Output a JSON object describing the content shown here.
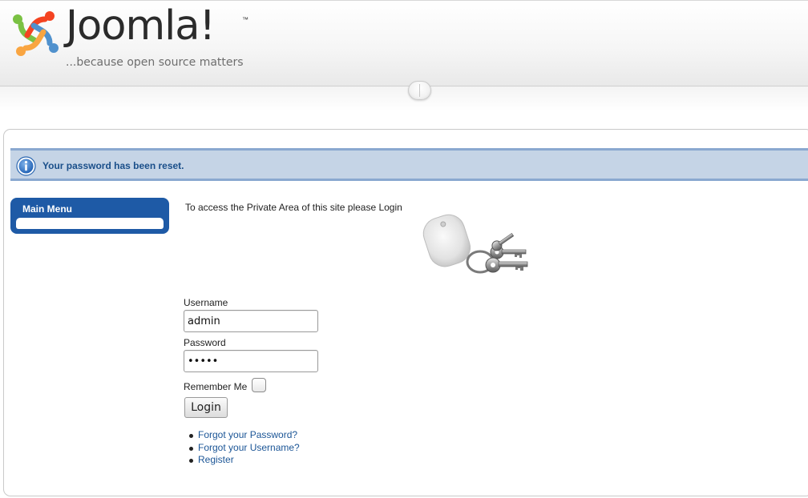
{
  "brand": {
    "name": "Joomla!",
    "wordmark": "Joomla!",
    "tagline": "...because open source matters",
    "logo_icon": "joomla-logo-icon",
    "logo_colors": [
      "#f44321",
      "#5091cd",
      "#f9a541",
      "#7ac143"
    ]
  },
  "message": {
    "icon": "info-icon",
    "text": "Your password has been reset."
  },
  "main_menu": {
    "title": "Main Menu"
  },
  "login": {
    "intro": "To access the Private Area of this site please Login",
    "image_icon": "keys-icon",
    "username_label": "Username",
    "username_value": "admin",
    "password_label": "Password",
    "password_value": "admin",
    "remember_label": "Remember Me",
    "remember_checked": false,
    "button_label": "Login",
    "links": [
      {
        "label": "Forgot your Password?"
      },
      {
        "label": "Forgot your Username?"
      },
      {
        "label": "Register"
      }
    ]
  },
  "colors": {
    "message_bg": "#c5d4e6",
    "message_border": "#8aa8d0",
    "message_text": "#1a4f8a",
    "menu_bg": "#1e5aa6",
    "link": "#1b5596"
  }
}
